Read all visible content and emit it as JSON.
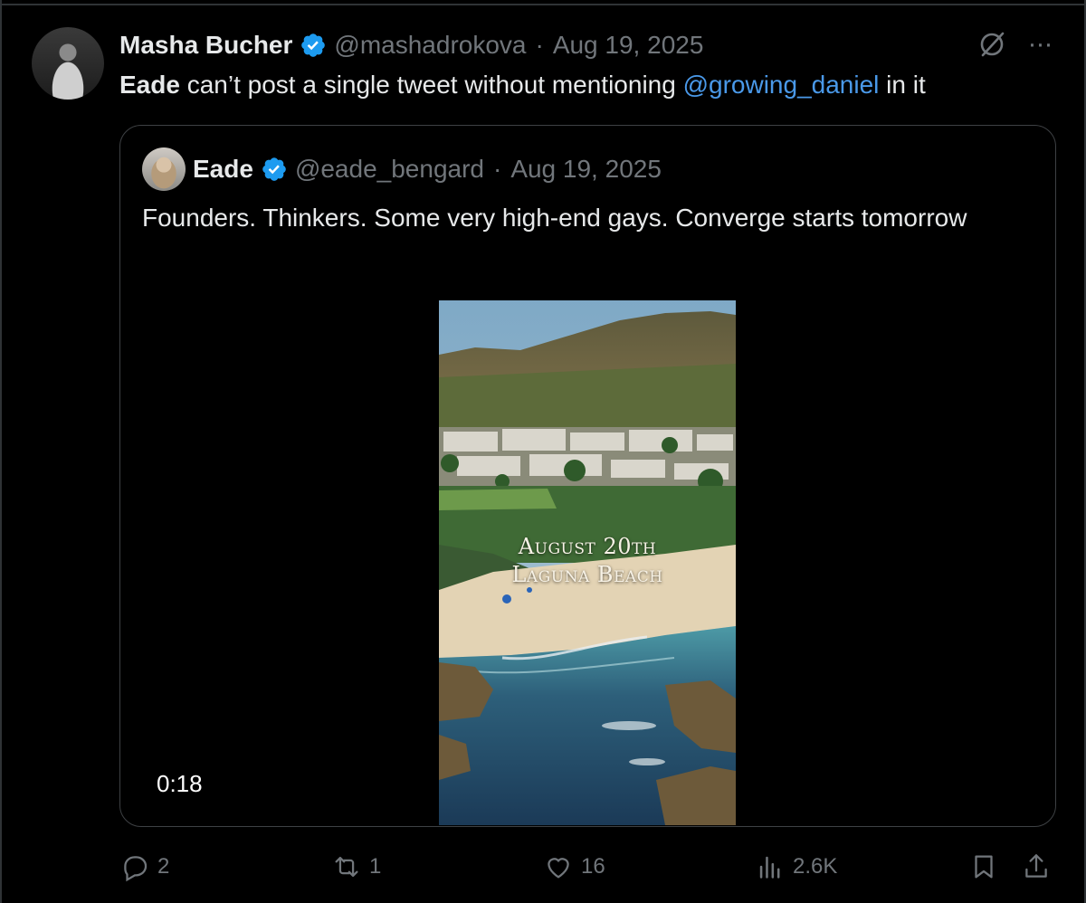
{
  "colors": {
    "background": "#000000",
    "text": "#e7e9ea",
    "muted": "#71767b",
    "link": "#4a99e9",
    "verified": "#1d9bf0"
  },
  "tweet": {
    "author_name": "Masha Bucher",
    "handle": "@mashadrokova",
    "separator": "·",
    "date": "Aug 19, 2025",
    "text_bold": "Eade",
    "text_before_mention": " can’t post a single tweet without mentioning ",
    "mention": "@growing_daniel",
    "text_after_mention": " in it"
  },
  "quoted_tweet": {
    "author_name": "Eade",
    "handle": "@eade_bengard",
    "separator": "·",
    "date": "Aug 19, 2025",
    "text": "Founders. Thinkers. Some very high-end gays. Converge starts tomorrow",
    "video": {
      "overlay_line_1": "August 20th",
      "overlay_line_2": "Laguna Beach",
      "duration": "0:18"
    }
  },
  "actions": {
    "replies": "2",
    "reposts": "1",
    "likes": "16",
    "views": "2.6K"
  },
  "icons": [
    "verified-badge-icon",
    "grok-icon",
    "more-icon",
    "reply-icon",
    "repost-icon",
    "like-icon",
    "views-icon",
    "bookmark-icon",
    "share-icon"
  ]
}
